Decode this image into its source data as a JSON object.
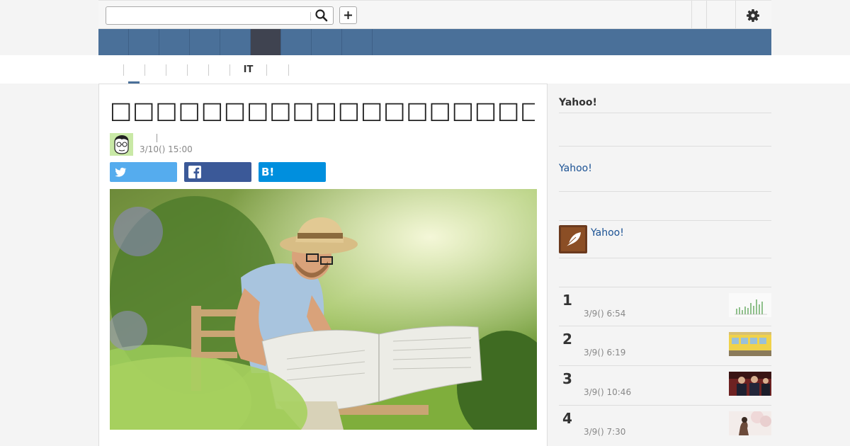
{
  "search": {
    "value": "",
    "placeholder": ""
  },
  "icons": {
    "search": "search-icon",
    "plus": "plus-icon",
    "gear": "gear-icon",
    "twitter": "twitter-icon",
    "facebook": "facebook-icon",
    "hatena": "hatena-bookmark-icon"
  },
  "colors": {
    "nav": "#4a7099",
    "nav_active": "#3f4350",
    "twitter": "#55acee",
    "facebook": "#3b5998",
    "hatena": "#008fde",
    "link": "#1a5193"
  },
  "subnav": {
    "tabs": [
      "",
      "",
      "",
      "",
      "",
      "IT",
      ""
    ]
  },
  "article": {
    "title": "□□□□□□□□□□□□□□□□□□□□□",
    "author": "",
    "date": "3/10() 15:00"
  },
  "share": {
    "twitter": "",
    "facebook": "",
    "hatena": "B!"
  },
  "sidebar": {
    "heading": "Yahoo!",
    "link1": "Yahoo!",
    "link2": "Yahoo!",
    "ranking": [
      {
        "rank": "1",
        "time": "3/9() 6:54"
      },
      {
        "rank": "2",
        "time": "3/9() 6:19"
      },
      {
        "rank": "3",
        "time": "3/9() 10:46"
      },
      {
        "rank": "4",
        "time": "3/9() 7:30"
      }
    ]
  }
}
